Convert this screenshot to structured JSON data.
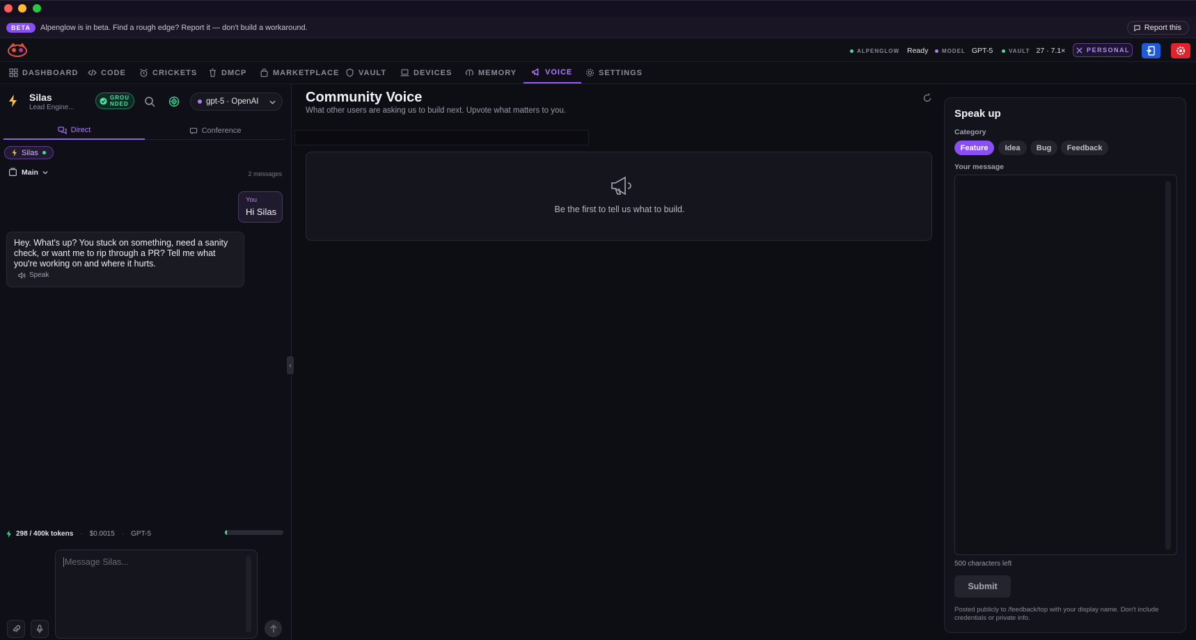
{
  "banner": {
    "badge": "BETA",
    "text": "Alpenglow is in beta. Find a rough edge? Report it — don't build a workaround.",
    "report_label": "Report this"
  },
  "status": {
    "alpenglow_key": "ALPENGLOW",
    "alpenglow_val": "Ready",
    "model_key": "MODEL",
    "model_val": "GPT-5",
    "vault_key": "VAULT",
    "vault_val": "27 · 7.1×",
    "personal_label": "PERSONAL"
  },
  "colors": {
    "accent": "#9a5bf5",
    "ready_dot": "#3fe09a",
    "model_dot": "#b17cf7",
    "danger": "#e0232c",
    "primary": "#1f5bd8"
  },
  "nav": {
    "tabs": [
      {
        "label": "DASHBOARD",
        "icon": "grid-icon"
      },
      {
        "label": "CODE",
        "icon": "code-icon"
      },
      {
        "label": "CRICKETS",
        "icon": "alarm-icon"
      },
      {
        "label": "DMCP",
        "icon": "trash-icon"
      },
      {
        "label": "MARKETPLACE",
        "icon": "bag-icon"
      },
      {
        "label": "VAULT",
        "icon": "shield-icon"
      },
      {
        "label": "DEVICES",
        "icon": "laptop-icon"
      },
      {
        "label": "MEMORY",
        "icon": "brain-icon"
      },
      {
        "label": "VOICE",
        "icon": "megaphone-icon"
      },
      {
        "label": "SETTINGS",
        "icon": "gear-icon"
      }
    ],
    "active": "VOICE"
  },
  "agent": {
    "name": "Silas",
    "role": "Lead Engine...",
    "grounded_label": "GROU NDED",
    "model_select": "gpt-5 · OpenAI"
  },
  "chat_tabs": {
    "direct": "Direct",
    "conference": "Conference"
  },
  "chip": {
    "label": "Silas"
  },
  "thread": {
    "branch": "Main",
    "message_count": "2 messages"
  },
  "messages": [
    {
      "role": "user",
      "who": "You",
      "text": "Hi Silas"
    },
    {
      "role": "assistant",
      "text": "Hey. What's up? You stuck on something, need a sanity check, or want me to rip through a PR? Tell me what you're working on and where it hurts.",
      "speak_label": "Speak"
    }
  ],
  "usage": {
    "tokens": "298 / 400k tokens",
    "cost": "$0.0015",
    "model": "GPT-5",
    "progress_fraction": 0.03
  },
  "composer": {
    "placeholder": "Message Silas..."
  },
  "main": {
    "title": "Community Voice",
    "subtitle": "What other users are asking us to build next. Upvote what matters to you.",
    "empty_text": "Be the first to tell us what to build."
  },
  "speak_up": {
    "title": "Speak up",
    "category_label": "Category",
    "categories": [
      "Feature",
      "Idea",
      "Bug",
      "Feedback"
    ],
    "selected_category": "Feature",
    "message_label": "Your message",
    "chars_left": "500 characters left",
    "submit_label": "Submit",
    "note": "Posted publicly to /feedback/top with your display name. Don't include credentials or private info."
  }
}
